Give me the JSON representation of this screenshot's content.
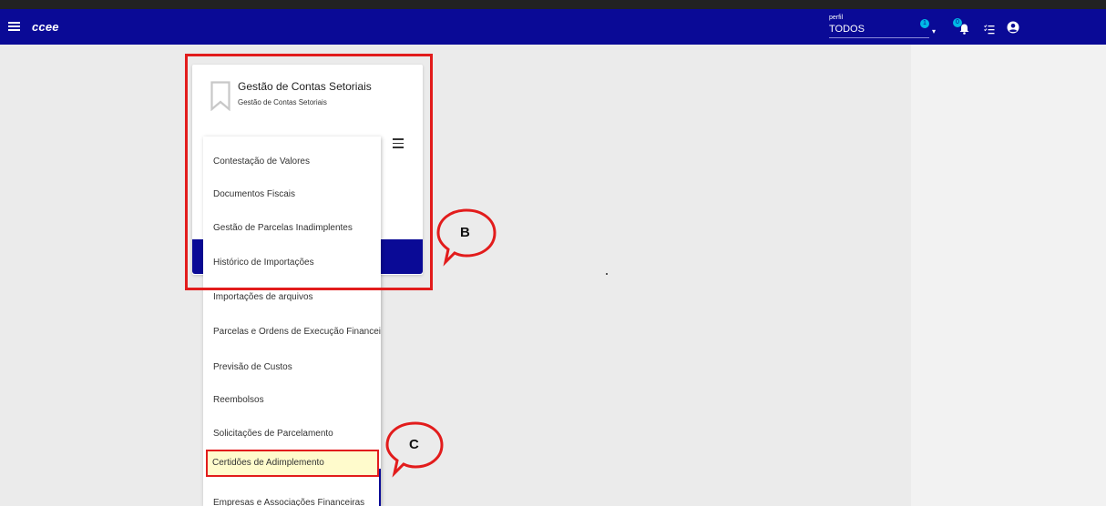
{
  "header": {
    "brand": "ccee",
    "profile_label": "perfil",
    "profile_value": "TODOS",
    "badge_one": "1",
    "badge_two": "0"
  },
  "card": {
    "title": "Gestão de Contas Setoriais",
    "subtitle": "Gestão de Contas Setoriais"
  },
  "menu": {
    "items": [
      "Contestação de Valores",
      "Documentos Fiscais",
      "Gestão de Parcelas Inadimplentes",
      "Histórico de Importações",
      "Importações de arquivos",
      "Parcelas e Ordens de Execução Financeira",
      "Previsão de Custos",
      "Reembolsos",
      "Solicitações de Parcelamento",
      "Certidões de Adimplemento",
      "Empresas e Associações Financeiras"
    ],
    "selected_item": "Certidões de Adimplemento"
  },
  "annotations": {
    "label_b": "B",
    "label_c": "C"
  },
  "colors": {
    "topbar": "#0a0a96",
    "badge": "#00b8e6",
    "annotation_red": "#e21c1c",
    "highlight": "#fffbcc"
  },
  "icons": [
    "menu-icon",
    "bell-icon",
    "tasks-icon",
    "user-circle-icon",
    "bookmark-icon",
    "hamburger-menu-icon"
  ]
}
